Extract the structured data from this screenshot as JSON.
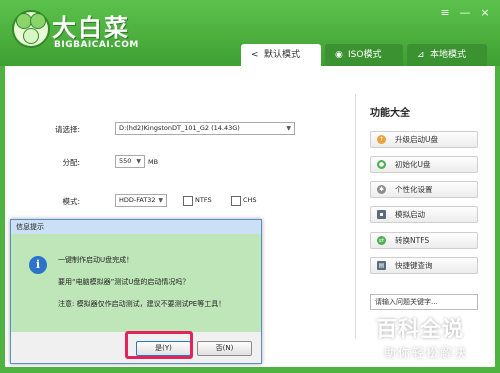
{
  "app": {
    "logo_title": "大白菜",
    "logo_sub": "BIGBAICAI.COM",
    "window_controls": [
      "≡",
      "—",
      "×"
    ]
  },
  "tabs": [
    {
      "label": "默认模式",
      "icon": "share-icon",
      "active": true
    },
    {
      "label": "ISO模式",
      "icon": "disc-icon",
      "active": false
    },
    {
      "label": "本地模式",
      "icon": "signal-icon",
      "active": false
    }
  ],
  "form": {
    "device_label": "请选择:",
    "device_value": "D:(hd2)KingstonDT_101_G2 (14.43G)",
    "alloc_label": "分配:",
    "alloc_value": "550",
    "alloc_unit": "MB",
    "mode_label": "模式:",
    "mode_value": "HDD-FAT32",
    "ntfs_label": "NTFS",
    "chs_label": "CHS"
  },
  "sidebar": {
    "title": "功能大全",
    "buttons": [
      {
        "label": "升级启动U盘",
        "icon": "upgrade-icon",
        "color": "#e8a33a"
      },
      {
        "label": "初始化U盘",
        "icon": "init-icon",
        "color": "#4caf50"
      },
      {
        "label": "个性化设置",
        "icon": "gear-icon",
        "color": "#8c8c8c"
      },
      {
        "label": "模拟启动",
        "icon": "monitor-icon",
        "color": "#5a6b7d"
      },
      {
        "label": "转换NTFS",
        "icon": "convert-icon",
        "color": "#4caf50"
      },
      {
        "label": "快捷键查询",
        "icon": "keyboard-icon",
        "color": "#5a6b7d"
      }
    ],
    "search_placeholder": "请输入问题关键字..."
  },
  "dialog": {
    "title": "信息提示",
    "lines": [
      "一键制作启动U盘完成！",
      "要用“电脑模拟器”测试U盘的启动情况吗？",
      "注意: 模拟器仅作启动测试，建议不要测试PE等工具！"
    ],
    "yes_label": "是(Y)",
    "no_label": "否(N)"
  },
  "watermark": {
    "main": "百科全说",
    "sub": "助你轻松解决"
  },
  "colors": {
    "brand_green": "#4fb341",
    "dialog_body": "#bfe6b8",
    "highlight": "#e0245e"
  }
}
